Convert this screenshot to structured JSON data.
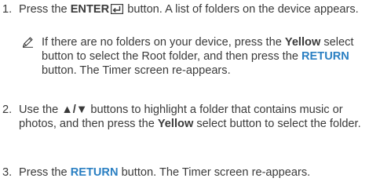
{
  "steps": [
    {
      "number": "1.",
      "t1": "Press the ",
      "button": "ENTER",
      "t2": " button. A list of folders on the device appears."
    },
    {
      "number": "2.",
      "t1": "Use the ",
      "arrows": "▲/▼",
      "t2": " buttons to highlight a folder that contains music or photos, and then press the ",
      "yellow": "Yellow",
      "t3": " select button to select the folder."
    },
    {
      "number": "3.",
      "t1": "Press the ",
      "return": "RETURN",
      "t2": " button. The Timer screen re-appears."
    }
  ],
  "note": {
    "t1": "If there are no folders on your device, press the ",
    "yellow": "Yellow",
    "t2": " select button to select the Root folder, and then press the ",
    "return": "RETURN",
    "t3": " button. The Timer screen re-appears."
  },
  "icons": {
    "enter": "enter-return-arrow-icon",
    "note": "pencil-note-icon"
  },
  "colors": {
    "text": "#3a3a3a",
    "return_button": "#2a7fc2"
  }
}
